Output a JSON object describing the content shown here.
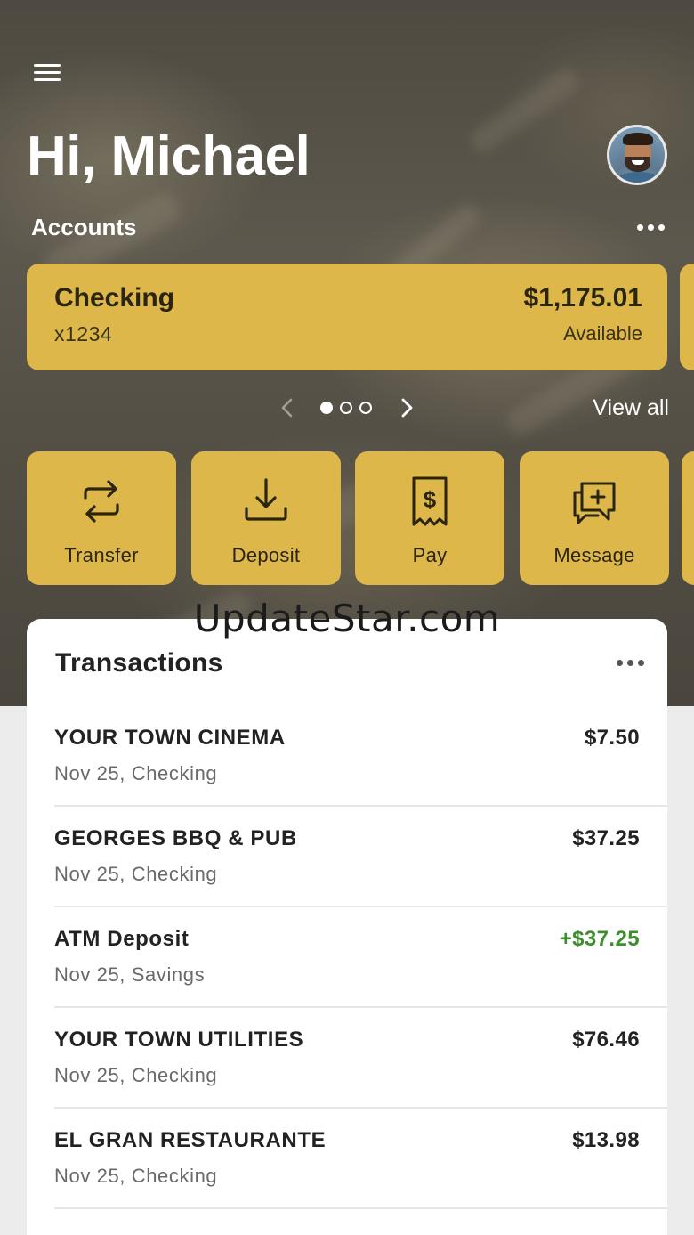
{
  "header": {
    "greeting": "Hi, Michael",
    "accounts_label": "Accounts"
  },
  "account": {
    "name": "Checking",
    "number": "x1234",
    "balance": "$1,175.01",
    "balance_label": "Available"
  },
  "pager": {
    "current_page": 1,
    "total_pages": 3,
    "view_all_label": "View all"
  },
  "actions": [
    {
      "label": "Transfer",
      "icon": "transfer-icon"
    },
    {
      "label": "Deposit",
      "icon": "deposit-icon"
    },
    {
      "label": "Pay",
      "icon": "pay-bill-icon"
    },
    {
      "label": "Message",
      "icon": "message-icon"
    }
  ],
  "watermark": "UpdateStar.com",
  "transactions": {
    "title": "Transactions",
    "items": [
      {
        "name": "YOUR TOWN CINEMA",
        "detail": "Nov 25, Checking",
        "amount": "$7.50",
        "type": "debit"
      },
      {
        "name": "GEORGES BBQ & PUB",
        "detail": "Nov 25, Checking",
        "amount": "$37.25",
        "type": "debit"
      },
      {
        "name": "ATM Deposit",
        "detail": "Nov 25, Savings",
        "amount": "+$37.25",
        "type": "credit"
      },
      {
        "name": "YOUR TOWN UTILITIES",
        "detail": "Nov 25, Checking",
        "amount": "$76.46",
        "type": "debit"
      },
      {
        "name": "EL GRAN RESTAURANTE",
        "detail": "Nov 25, Checking",
        "amount": "$13.98",
        "type": "debit"
      }
    ]
  },
  "colors": {
    "accent": "#ddb74a",
    "credit": "#3e8e2e",
    "panel": "#ffffff",
    "page_bg": "#ececec"
  }
}
